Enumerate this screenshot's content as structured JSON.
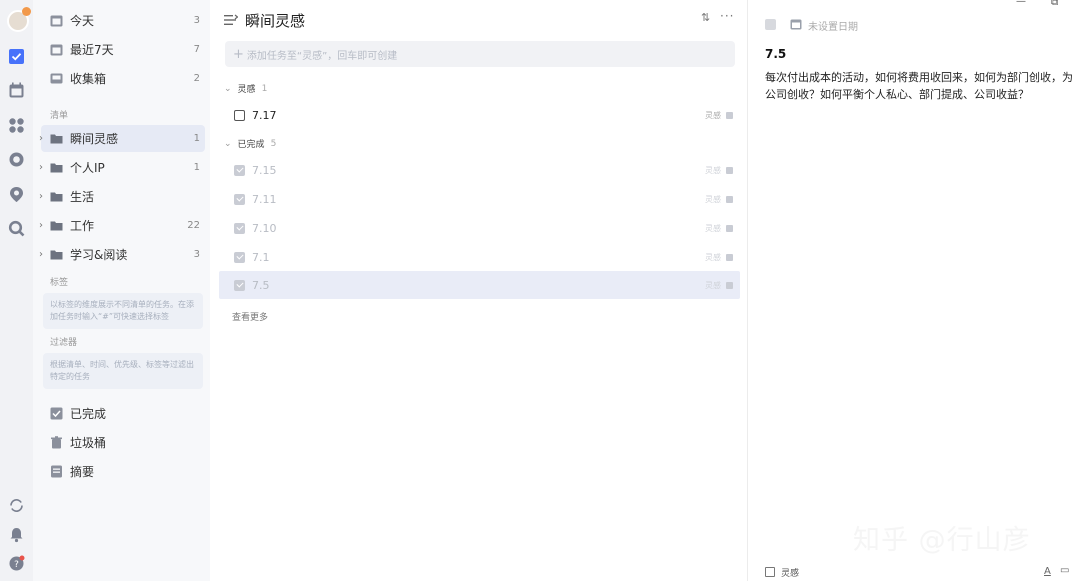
{
  "sidebar": {
    "smart_lists": [
      {
        "label": "今天",
        "count": "3"
      },
      {
        "label": "最近7天",
        "count": "7"
      },
      {
        "label": "收集箱",
        "count": "2"
      }
    ],
    "lists_section_label": "清单",
    "lists": [
      {
        "label": "瞬间灵感",
        "count": "1"
      },
      {
        "label": "个人IP",
        "count": "1"
      },
      {
        "label": "生活",
        "count": ""
      },
      {
        "label": "工作",
        "count": "22"
      },
      {
        "label": "学习&阅读",
        "count": "3"
      }
    ],
    "tags_section_label": "标签",
    "tags_hint": "以标签的维度展示不同清单的任务。在添加任务时输入“#”可快速选择标签",
    "filters_section_label": "过滤器",
    "filters_hint": "根据清单、时间、优先级、标签等过滤出特定的任务",
    "bottom_items": [
      {
        "label": "已完成"
      },
      {
        "label": "垃圾桶"
      },
      {
        "label": "摘要"
      }
    ]
  },
  "main": {
    "title": "瞬间灵感",
    "add_placeholder": "添加任务至“灵感”，回车即可创建",
    "groups": [
      {
        "label": "灵感",
        "count": "1"
      },
      {
        "label": "已完成",
        "count": "5"
      }
    ],
    "open_tasks": [
      {
        "title": "7.17",
        "tag": "灵感"
      }
    ],
    "done_tasks": [
      {
        "title": "7.15",
        "tag": "灵感"
      },
      {
        "title": "7.11",
        "tag": "灵感"
      },
      {
        "title": "7.10",
        "tag": "灵感"
      },
      {
        "title": "7.1",
        "tag": "灵感"
      },
      {
        "title": "7.5",
        "tag": "灵感"
      }
    ],
    "view_more": "查看更多"
  },
  "detail": {
    "date_placeholder": "未设置日期",
    "title": "7.5",
    "body": "每次付出成本的活动，如何将费用收回来，如何为部门创收，为公司创收？如何平衡个人私心、部门提成、公司收益？",
    "list_tag": "灵感",
    "watermark": "知乎 @行山彦"
  },
  "colors": {
    "accent": "#4772fa",
    "selected_row": "#e9ecf7",
    "sidebar_bg": "#f7f8fa",
    "rail_bg": "#f1f2f5"
  }
}
